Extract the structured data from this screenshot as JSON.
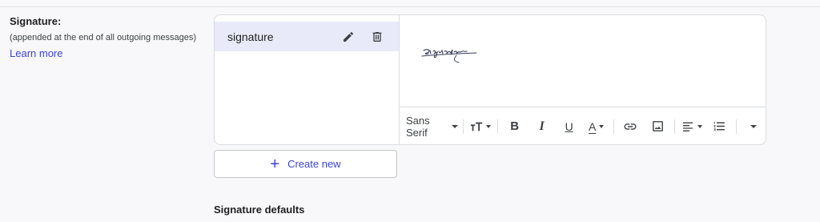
{
  "signature_section": {
    "title": "Signature:",
    "subtitle": "(appended at the end of all outgoing messages)",
    "learn_more": "Learn more"
  },
  "signatures": [
    {
      "name": "signature",
      "selected": true
    }
  ],
  "toolbar": {
    "font_family": "Sans Serif",
    "buttons": [
      "text-size-icon",
      "bold-icon",
      "italic-icon",
      "underline-icon",
      "text-color-icon",
      "link-icon",
      "image-icon",
      "align-icon",
      "numbered-list-icon",
      "more-options-icon"
    ]
  },
  "create_new_label": "Create new",
  "defaults_heading": "Signature defaults",
  "colors": {
    "accent": "#3b42d6",
    "selected_row": "#e8eaf9",
    "border": "#dadce0"
  }
}
